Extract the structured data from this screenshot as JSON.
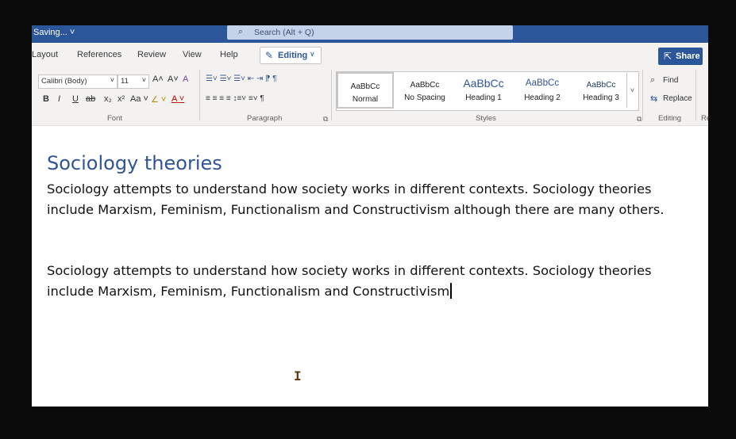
{
  "titlebar": {
    "status": "Saving... ˅",
    "search_placeholder": "Search (Alt + Q)"
  },
  "tabs": [
    {
      "label": "Layout"
    },
    {
      "label": "References"
    },
    {
      "label": "Review"
    },
    {
      "label": "View"
    },
    {
      "label": "Help"
    }
  ],
  "editing_mode": {
    "label": "Editing",
    "icon": "pencil-icon"
  },
  "share": {
    "label": "Share",
    "icon": "share-icon"
  },
  "ribbon": {
    "font": {
      "name": "Calibri (Body)",
      "size": "11",
      "grow": "A˄",
      "shrink": "A˅",
      "clear": "A",
      "bold": "B",
      "italic": "I",
      "underline": "U",
      "strike": "ab",
      "subscript": "x₂",
      "superscript": "x²",
      "case": "Aa ˅",
      "highlight": "∠ ˅",
      "font_color": "A ˅",
      "group_label": "Font"
    },
    "paragraph": {
      "group_label": "Paragraph",
      "row1": "☰˅ ☰˅ ☰˅ ⇤ ⇥ ⁋ ¶",
      "row2": "≡ ≡ ≡ ≡ ↕≡˅ ≡˅ ¶"
    },
    "styles": {
      "group_label": "Styles",
      "items": [
        {
          "sample": "AaBbCc",
          "name": "Normal"
        },
        {
          "sample": "AaBbCc",
          "name": "No Spacing"
        },
        {
          "sample": "AaBbCc",
          "name": "Heading 1"
        },
        {
          "sample": "AaBbCc",
          "name": "Heading 2"
        },
        {
          "sample": "AaBbCc",
          "name": "Heading 3"
        }
      ]
    },
    "editing": {
      "group_label": "Editing",
      "find": "Find",
      "replace": "Replace"
    },
    "cut_off_label": "Re"
  },
  "document": {
    "heading": "Sociology theories",
    "paragraph1": "Sociology attempts to understand how society works in different contexts. Sociology theories include Marxism, Feminism, Functionalism and Constructivism although there are many others.",
    "paragraph2": "Sociology attempts to understand how society works in different contexts. Sociology theories include Marxism, Feminism, Functionalism and Constructivism"
  },
  "colors": {
    "titlebar": "#2b579a",
    "heading": "#2f5496",
    "accent": "#2b579a"
  }
}
